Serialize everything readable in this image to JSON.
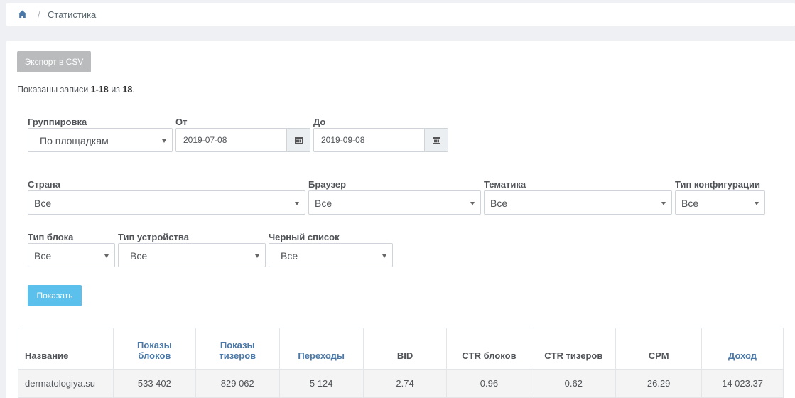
{
  "breadcrumb": {
    "home_icon": "home-icon",
    "separator": "/",
    "current": "Статистика"
  },
  "toolbar": {
    "export_label": "Экспорт в CSV"
  },
  "summary": {
    "prefix": "Показаны записи ",
    "range": "1-18",
    "middle": " из ",
    "total": "18",
    "suffix": "."
  },
  "filters": {
    "grouping": {
      "label": "Группировка",
      "value": "По площадкам"
    },
    "from": {
      "label": "От",
      "value": "2019-07-08"
    },
    "to": {
      "label": "До",
      "value": "2019-09-08"
    },
    "country": {
      "label": "Страна",
      "value": "Все"
    },
    "browser": {
      "label": "Браузер",
      "value": "Все"
    },
    "topic": {
      "label": "Тематика",
      "value": "Все"
    },
    "config_type": {
      "label": "Тип конфигурации",
      "value": "Все"
    },
    "block_type": {
      "label": "Тип блока",
      "value": "Все"
    },
    "device_type": {
      "label": "Тип устройства",
      "value": "Все"
    },
    "blacklist": {
      "label": "Черный список",
      "value": "Все"
    },
    "show_label": "Показать"
  },
  "table": {
    "headers": {
      "name": "Название",
      "block_views_1": "Показы",
      "block_views_2": "блоков",
      "teaser_views_1": "Показы",
      "teaser_views_2": "тизеров",
      "clicks": "Переходы",
      "bid": "BID",
      "ctr_blocks": "CTR блоков",
      "ctr_teasers": "CTR тизеров",
      "cpm": "CPM",
      "income": "Доход"
    },
    "rows": [
      {
        "name": "dermatologiya.su",
        "block_views": "533 402",
        "teaser_views": "829 062",
        "clicks": "5 124",
        "bid": "2.74",
        "ctr_blocks": "0.96",
        "ctr_teasers": "0.62",
        "cpm": "26.29",
        "income": "14 023.37"
      }
    ]
  },
  "colors": {
    "accent": "#5bc0eb",
    "link": "#4a78a8",
    "disabled_button": "#b9bbbd",
    "background": "#eef0f3"
  }
}
